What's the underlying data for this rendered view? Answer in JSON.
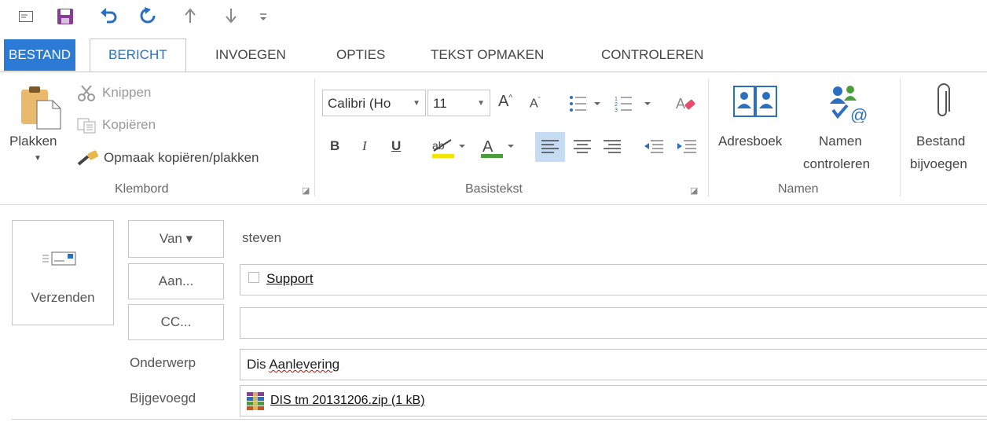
{
  "qat": {
    "icons": [
      "window-icon",
      "save-icon",
      "undo-icon",
      "redo-icon",
      "up-arrow-icon",
      "down-arrow-icon",
      "customize-icon"
    ]
  },
  "tabs": [
    "BESTAND",
    "BERICHT",
    "INVOEGEN",
    "OPTIES",
    "TEKST OPMAKEN",
    "CONTROLEREN"
  ],
  "clipboard": {
    "paste": "Plakken",
    "cut": "Knippen",
    "copy": "Kopiëren",
    "format_painter": "Opmaak kopiëren/plakken",
    "group_label": "Klembord"
  },
  "basic_text": {
    "font": "Calibri (Ho",
    "size": "11",
    "bold": "B",
    "italic": "I",
    "underline": "U",
    "group_label": "Basistekst",
    "highlight_color": "#f5e400",
    "font_color": "#c00000"
  },
  "names": {
    "address_book": "Adresboek",
    "check_names_1": "Namen",
    "check_names_2": "controleren",
    "group_label": "Namen"
  },
  "attach": {
    "label_1": "Bestand",
    "label_2": "bijvoegen"
  },
  "compose": {
    "send": "Verzenden",
    "from_btn": "Van ▾",
    "from_value": "steven",
    "to_btn": "Aan...",
    "to_value": "Support",
    "cc_btn": "CC...",
    "cc_value": "",
    "subject_label": "Onderwerp",
    "subject_prefix": "Dis ",
    "subject_misspelled": "Aanlevering",
    "attached_label": "Bijgevoegd",
    "attachment": "DIS tm 20131206.zip (1 kB)"
  }
}
